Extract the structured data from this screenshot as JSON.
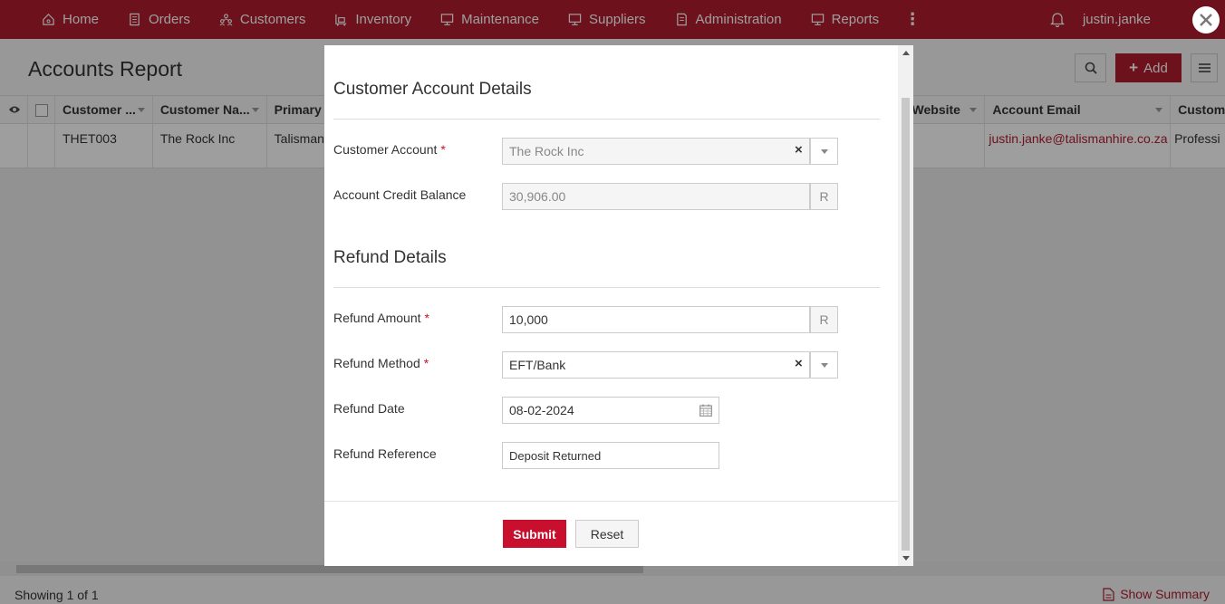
{
  "nav": {
    "items": [
      {
        "label": "Home",
        "icon": "home-icon"
      },
      {
        "label": "Orders",
        "icon": "orders-icon"
      },
      {
        "label": "Customers",
        "icon": "customers-icon"
      },
      {
        "label": "Inventory",
        "icon": "inventory-icon"
      },
      {
        "label": "Maintenance",
        "icon": "maintenance-icon"
      },
      {
        "label": "Suppliers",
        "icon": "suppliers-icon"
      },
      {
        "label": "Administration",
        "icon": "administration-icon"
      },
      {
        "label": "Reports",
        "icon": "reports-icon"
      }
    ],
    "more": "⋮",
    "username": "justin.janke",
    "brand_color": "#b01c2e"
  },
  "page": {
    "title": "Accounts Report",
    "add_label": "Add"
  },
  "table": {
    "columns": [
      "Customer ...",
      "Customer Na...",
      "Primary S",
      "Website",
      "Account Email",
      "Custome"
    ],
    "row": {
      "code": "THET003",
      "name": "The Rock Inc",
      "primary": "Talisman",
      "email": "justin.janke@talismanhire.co.za",
      "type": "Professi"
    }
  },
  "footer": {
    "showing": "Showing 1 of 1",
    "summary_label": "Show Summary"
  },
  "modal": {
    "section1_title": "Customer Account Details",
    "customer_account_label": "Customer Account",
    "customer_account_value": "The Rock Inc",
    "credit_balance_label": "Account Credit Balance",
    "credit_balance_value": "30,906.00",
    "currency": "R",
    "section2_title": "Refund Details",
    "refund_amount_label": "Refund Amount",
    "refund_amount_value": "10,000",
    "refund_method_label": "Refund Method",
    "refund_method_value": "EFT/Bank",
    "refund_date_label": "Refund Date",
    "refund_date_value": "08-02-2024",
    "refund_reference_label": "Refund Reference",
    "refund_reference_value": "Deposit Returned",
    "required_mark": "*",
    "clear_mark": "×",
    "submit_label": "Submit",
    "reset_label": "Reset"
  }
}
